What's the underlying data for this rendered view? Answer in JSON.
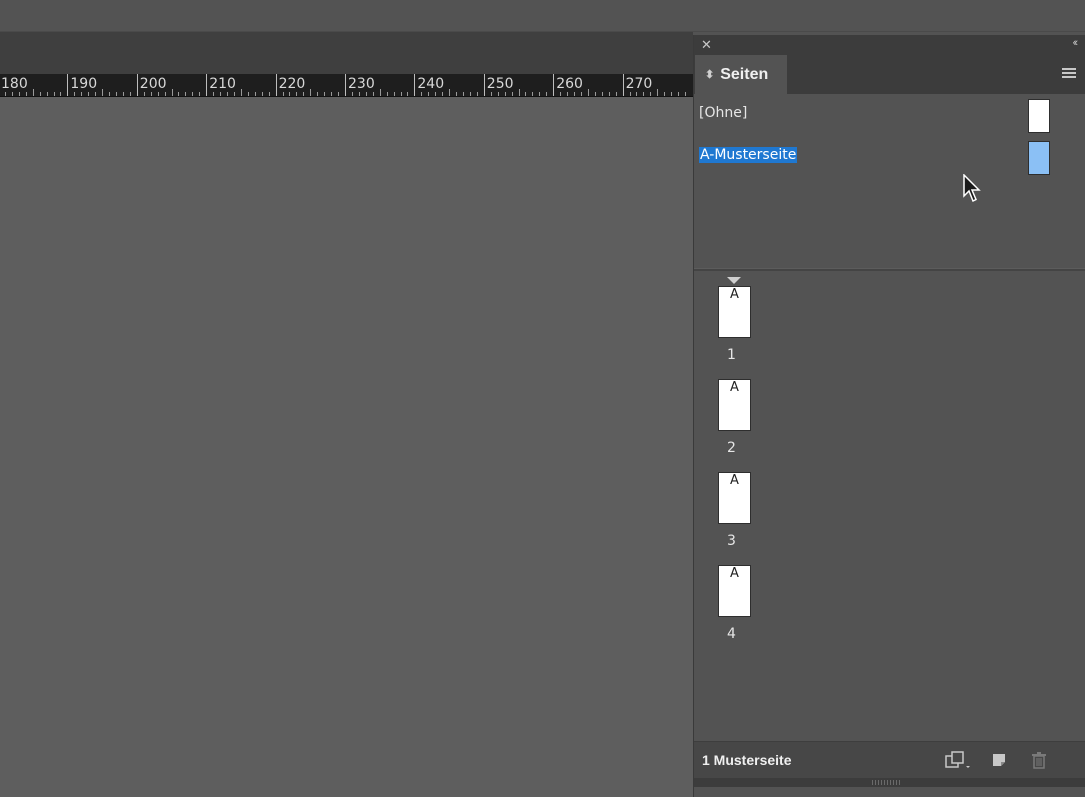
{
  "ruler": {
    "labels": [
      "180",
      "190",
      "200",
      "210",
      "220",
      "230",
      "240",
      "250",
      "260",
      "270"
    ]
  },
  "panel": {
    "tab_label": "Seiten",
    "tab_arrows_icon": "updown-arrows-icon",
    "close_glyph": "✕",
    "collapse_glyph": "‹‹",
    "masters": [
      {
        "label": "[Ohne]",
        "selected": false,
        "color": "#ffffff"
      },
      {
        "label": "A-Musterseite",
        "selected": true,
        "color": "#8bc0f5"
      }
    ],
    "pages": [
      {
        "number": "1",
        "master_letter": "A"
      },
      {
        "number": "2",
        "master_letter": "A"
      },
      {
        "number": "3",
        "master_letter": "A"
      },
      {
        "number": "4",
        "master_letter": "A"
      }
    ],
    "footer_status": "1 Musterseite"
  },
  "colors": {
    "selection": "#1f78d1",
    "canvas": "#5e5e5e",
    "panel": "#535353"
  }
}
